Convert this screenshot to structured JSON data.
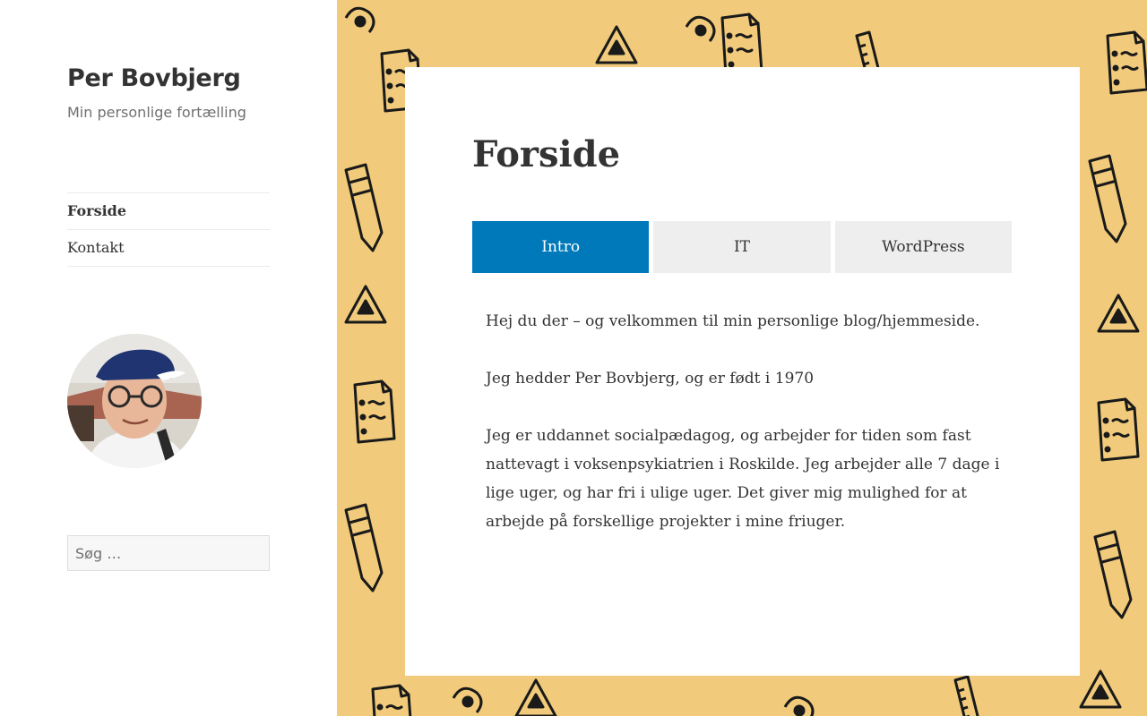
{
  "site": {
    "title": "Per Bovbjerg",
    "description": "Min personlige fortælling"
  },
  "nav": {
    "items": [
      {
        "label": "Forside",
        "current": true
      },
      {
        "label": "Kontakt",
        "current": false
      }
    ]
  },
  "search": {
    "placeholder": "Søg …"
  },
  "page": {
    "title": "Forside",
    "tabs": [
      {
        "label": "Intro",
        "active": true
      },
      {
        "label": "IT",
        "active": false
      },
      {
        "label": "WordPress",
        "active": false
      }
    ],
    "paragraphs": [
      "Hej du der – og velkommen til min personlige blog/hjemmeside.",
      "Jeg hedder Per Bovbjerg, og er født i 1970",
      "Jeg er uddannet socialpædagog, og arbejder for tiden som fast nattevagt i voksenpsykiatrien i Roskilde.  Jeg arbejder alle 7 dage i lige uger, og har fri i ulige uger. Det giver mig mulighed for at arbejde på forskellige projekter i mine friuger."
    ]
  },
  "colors": {
    "accent": "#0079bb",
    "background": "#f1cb7b",
    "tab_inactive": "#eeeeee"
  }
}
